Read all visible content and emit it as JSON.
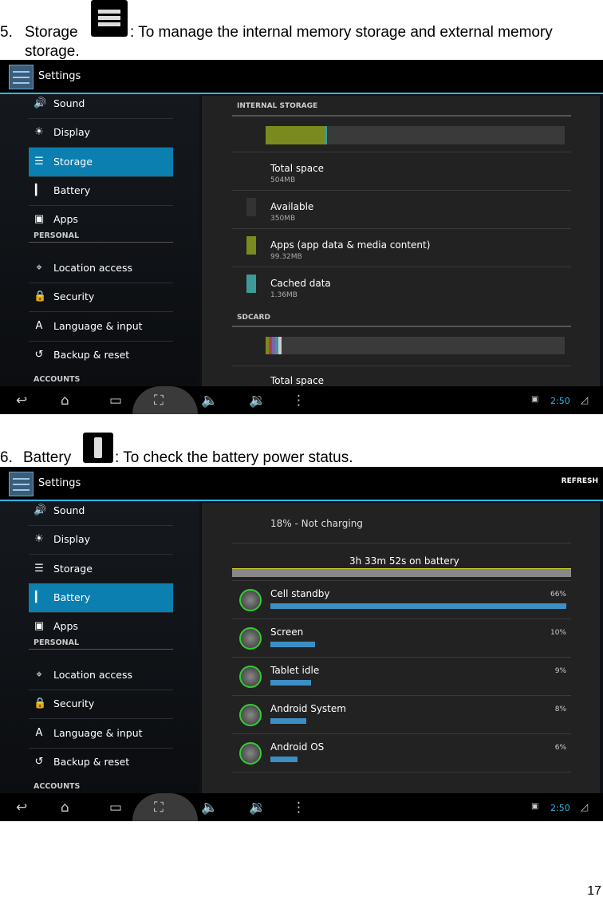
{
  "section5": {
    "number": "5.",
    "title": "Storage",
    "description": ": To manage the internal memory storage and external memory",
    "description_cont": "storage."
  },
  "section6": {
    "number": "6.",
    "title": "Battery",
    "description": ": To check the battery power status."
  },
  "page_number": "17",
  "settings_title": "Settings",
  "sidebar": {
    "items": [
      {
        "label": "Sound",
        "icon": "speaker-icon"
      },
      {
        "label": "Display",
        "icon": "brightness-icon"
      },
      {
        "label": "Storage",
        "icon": "storage-icon"
      },
      {
        "label": "Battery",
        "icon": "battery-icon"
      },
      {
        "label": "Apps",
        "icon": "apps-icon"
      },
      {
        "label": "Location access",
        "icon": "location-icon"
      },
      {
        "label": "Security",
        "icon": "lock-icon"
      },
      {
        "label": "Language & input",
        "icon": "keyboard-icon"
      },
      {
        "label": "Backup & reset",
        "icon": "restore-icon"
      }
    ],
    "headers": [
      "PERSONAL",
      "ACCOUNTS"
    ]
  },
  "storage_screen": {
    "selected": "Storage",
    "internal_label": "INTERNAL STORAGE",
    "usage_fractions": {
      "apps": 0.197,
      "cached": 0.003
    },
    "rows": [
      {
        "title": "Total space",
        "value": "504MB",
        "color": ""
      },
      {
        "title": "Available",
        "value": "350MB",
        "color": "#333333"
      },
      {
        "title": "Apps (app data & media content)",
        "value": "99.32MB",
        "color": "#7a8a1e"
      },
      {
        "title": "Cached data",
        "value": "1.36MB",
        "color": "#3e9a9a"
      }
    ],
    "sdcard_label": "SDCARD",
    "sd_total_label": "Total space"
  },
  "battery_screen": {
    "selected": "Battery",
    "refresh": "REFRESH",
    "status": "18% - Not charging",
    "time_on_battery": "3h 33m 52s on battery",
    "usage": [
      {
        "name": "Cell standby",
        "percent": "66%",
        "value": 66,
        "icon": "cell-signal-icon"
      },
      {
        "name": "Screen",
        "percent": "10%",
        "value": 10,
        "icon": "brightness-icon"
      },
      {
        "name": "Tablet idle",
        "percent": "9%",
        "value": 9,
        "icon": "power-icon"
      },
      {
        "name": "Android System",
        "percent": "8%",
        "value": 8,
        "icon": "android-icon"
      },
      {
        "name": "Android OS",
        "percent": "6%",
        "value": 6,
        "icon": "android-icon"
      }
    ]
  },
  "status_bar": {
    "time": "2:50"
  },
  "colors": {
    "accent": "#33b5e5",
    "selected": "#0b7fb0",
    "usage_bar": "#3d8ec4"
  }
}
